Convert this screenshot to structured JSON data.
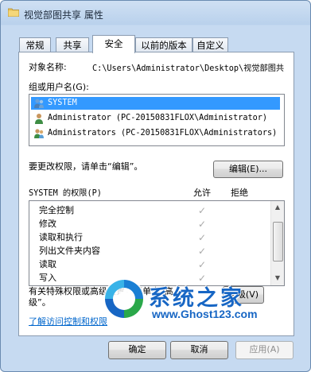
{
  "window": {
    "title": "视觉部图共享 属性",
    "icon": "folder-icon"
  },
  "tabs": [
    {
      "label": "常规"
    },
    {
      "label": "共享"
    },
    {
      "label": "安全"
    },
    {
      "label": "以前的版本"
    },
    {
      "label": "自定义"
    }
  ],
  "security": {
    "object_name_label": "对象名称:",
    "object_name_value": "C:\\Users\\Administrator\\Desktop\\视觉部图共",
    "groups_label": "组或用户名(G):",
    "users": [
      {
        "name": "SYSTEM",
        "selected": true,
        "icon": "system-user-icon"
      },
      {
        "name": "Administrator (PC-20150831FLOX\\Administrator)",
        "selected": false,
        "icon": "admin-user-icon"
      },
      {
        "name": "Administrators (PC-20150831FLOX\\Administrators)",
        "selected": false,
        "icon": "admin-group-icon"
      }
    ],
    "edit_hint": "要更改权限，请单击“编辑”。",
    "edit_button": "编辑(E)...",
    "perm_header": "SYSTEM 的权限(P)",
    "allow_header": "允许",
    "deny_header": "拒绝",
    "permissions": [
      {
        "name": "完全控制",
        "allow": "✓",
        "deny": ""
      },
      {
        "name": "修改",
        "allow": "✓",
        "deny": ""
      },
      {
        "name": "读取和执行",
        "allow": "✓",
        "deny": ""
      },
      {
        "name": "列出文件夹内容",
        "allow": "✓",
        "deny": ""
      },
      {
        "name": "读取",
        "allow": "✓",
        "deny": ""
      },
      {
        "name": "写入",
        "allow": "✓",
        "deny": ""
      }
    ],
    "special_text_line1": "有关特殊权限或高级设置，请单击“高",
    "special_text_line2": "级”。",
    "advanced_button": "高级(V)",
    "learn_link": "了解访问控制和权限"
  },
  "footer": {
    "ok": "确定",
    "cancel": "取消",
    "apply": "应用(A)"
  },
  "watermark": {
    "title": "系统之家",
    "url": "www.Ghost123.com"
  },
  "colors": {
    "selection": "#3399ff",
    "link": "#0066cc",
    "watermark": "#1766c4"
  }
}
